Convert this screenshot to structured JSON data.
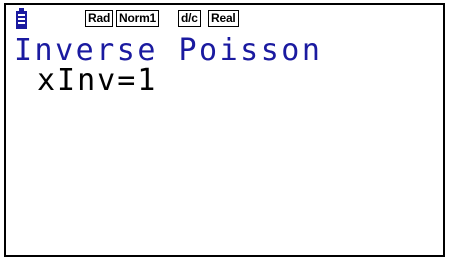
{
  "status_bar": {
    "icons": [
      "battery-icon"
    ],
    "angle_mode": "Rad",
    "display_mode": "Norm1",
    "fraction_mode": "d/c",
    "complex_mode": "Real",
    "colors": {
      "battery": "#1a1aa0",
      "frame": "#000000"
    }
  },
  "screen": {
    "title": "Inverse Poisson",
    "title_color": "#1a1aa0",
    "lines": [
      {
        "label": "xInv=1"
      }
    ]
  }
}
